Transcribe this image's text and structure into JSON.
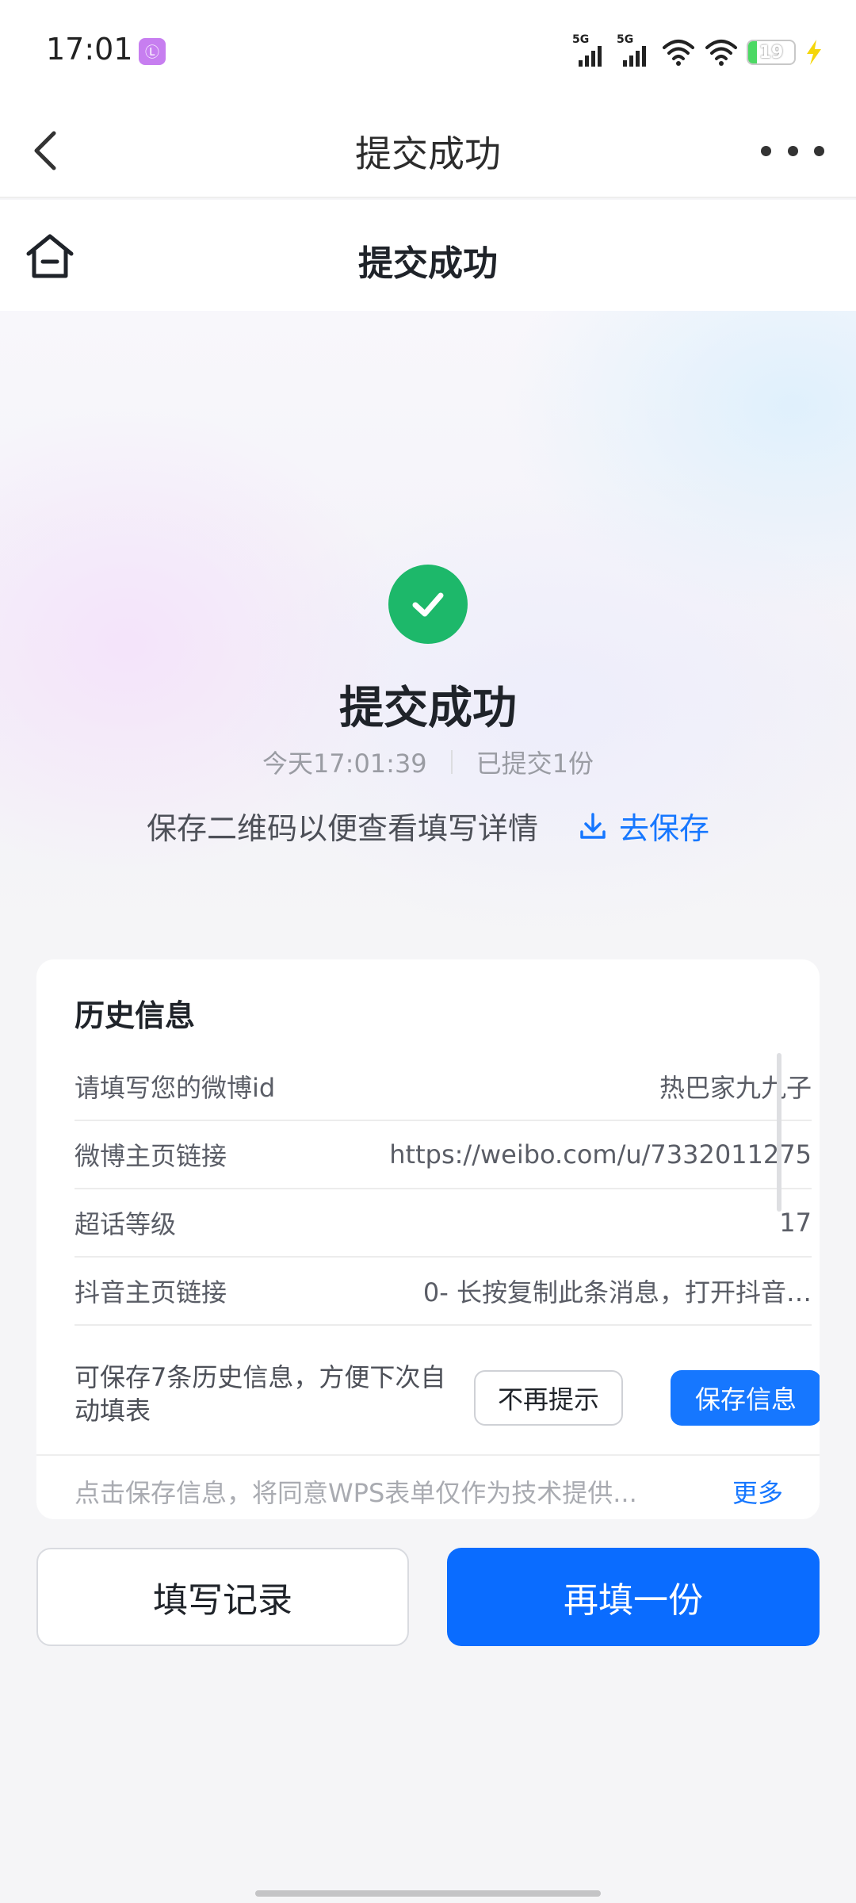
{
  "status_bar": {
    "time": "17:01",
    "app_icon_glyph": "Ⓛ",
    "signal1_label": "5G",
    "signal2_label": "5G",
    "battery_level": "19",
    "battery_fraction": 0.19
  },
  "navbar": {
    "title": "提交成功"
  },
  "subheader": {
    "title": "提交成功"
  },
  "hero": {
    "title": "提交成功",
    "time": "今天17:01:39",
    "count": "已提交1份",
    "save_hint": "保存二维码以便查看填写详情",
    "save_link": "去保存"
  },
  "history": {
    "title": "历史信息",
    "rows": [
      {
        "label": "请填写您的微博id",
        "value": "热巴家九九子"
      },
      {
        "label": "微博主页链接",
        "value": "https://weibo.com/u/7332011275"
      },
      {
        "label": "超话等级",
        "value": "17"
      },
      {
        "label": "抖音主页链接",
        "value": "0- 长按复制此条消息，打开抖音…"
      }
    ],
    "prompt": "可保存7条历史信息，方便下次自动填表",
    "btn_no_more": "不再提示",
    "btn_save": "保存信息",
    "footer_text": "点击保存信息，将同意WPS表单仅作为技术提供...",
    "footer_more": "更多"
  },
  "actions": {
    "record": "填写记录",
    "again": "再填一份"
  },
  "colors": {
    "accent": "#1677ff",
    "success": "#1db86a"
  }
}
